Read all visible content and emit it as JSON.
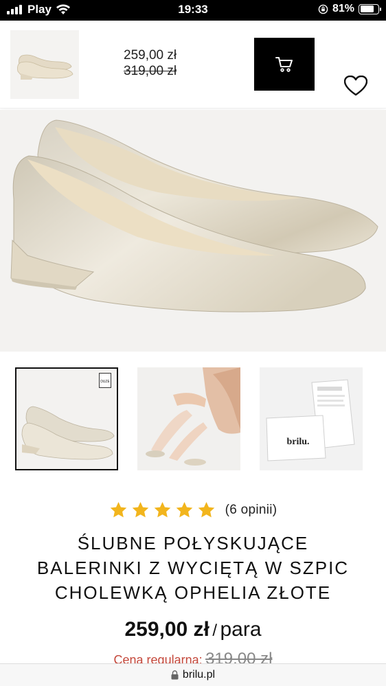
{
  "status_bar": {
    "carrier": "Play",
    "time": "19:33",
    "battery_percent": "81%",
    "battery_level": 0.81,
    "icons": [
      "signal-icon",
      "wifi-icon",
      "orientation-lock-icon",
      "battery-icon"
    ]
  },
  "sticky_header": {
    "price_current": "259,00 zł",
    "price_old": "319,00 zł",
    "cart_icon": "cart-icon",
    "wishlist_icon": "heart-icon"
  },
  "gallery": {
    "thumbnails": [
      {
        "name": "shoe-side-view",
        "active": true,
        "badge": "DUZE"
      },
      {
        "name": "model-wearing-shoes",
        "active": false
      },
      {
        "name": "brilu-packaging",
        "active": false,
        "box_brand": "brilu."
      }
    ]
  },
  "rating": {
    "stars": 5,
    "reviews_label": "(6 opinii)"
  },
  "product": {
    "title_line1": "ŚLUBNE POŁYSKUJĄCE",
    "title_line2": "BALERINKI Z WYCIĘTĄ W SZPIC",
    "title_line3": "CHOLEWKĄ OPHELIA ZŁOTE",
    "price": "259,00 zł",
    "price_separator": "/",
    "price_unit": "para",
    "regular_label": "Cena regularna:",
    "regular_price": "319,00 zł"
  },
  "browser": {
    "url": "brilu.pl"
  },
  "colors": {
    "accent_black": "#000000",
    "star_gold": "#f2b51d",
    "regular_red": "#c4473a"
  }
}
